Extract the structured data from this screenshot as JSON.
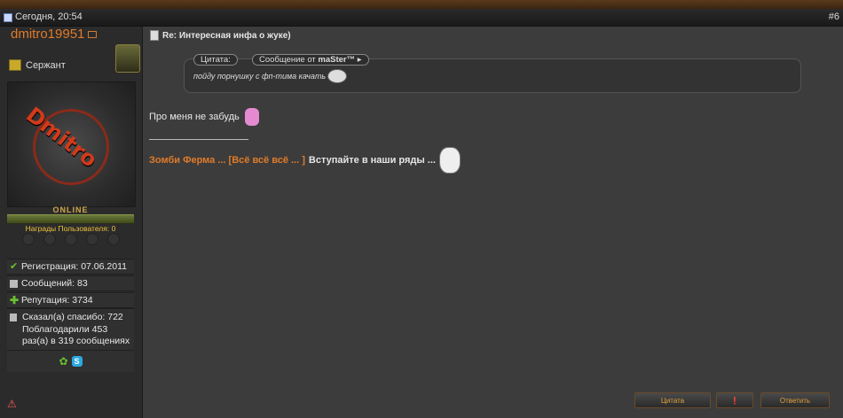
{
  "post_header": {
    "date": "Сегодня, 20:54",
    "post_number": "#6"
  },
  "user": {
    "username": "dmitro19951",
    "rank": "Сержант",
    "avatar_text": "Dmitro",
    "online_status": "ONLINE",
    "awards_label": "Награды Пользователя: 0",
    "registration": "Регистрация: 07.06.2011",
    "messages": "Сообщений: 83",
    "reputation": "Репутация: 3734",
    "thanks_lines": [
      "Сказал(а) спасибо: 722",
      "Поблагодарили 453",
      "раз(а) в 319 сообщениях"
    ],
    "contact_icons": [
      "icq-icon",
      "skype-icon"
    ]
  },
  "post": {
    "title": "Re: Интересная инфа о жуке)",
    "quote_tag": "Цитата:",
    "quote_from_prefix": "Сообщение от",
    "quote_author": "maSter™",
    "quote_text": "пойду порнушку с фп-тима качать",
    "message": "Про меня не забудь",
    "signature_link": "Зомби Ферма ... [Всё всё всё ... ]",
    "signature_text": "Вступайте в наши ряды ..."
  },
  "actions": {
    "quote_button": "Цитата",
    "reply_button": "Ответить"
  },
  "colors": {
    "accent": "#e07b2a",
    "background": "#3c3c3c"
  }
}
